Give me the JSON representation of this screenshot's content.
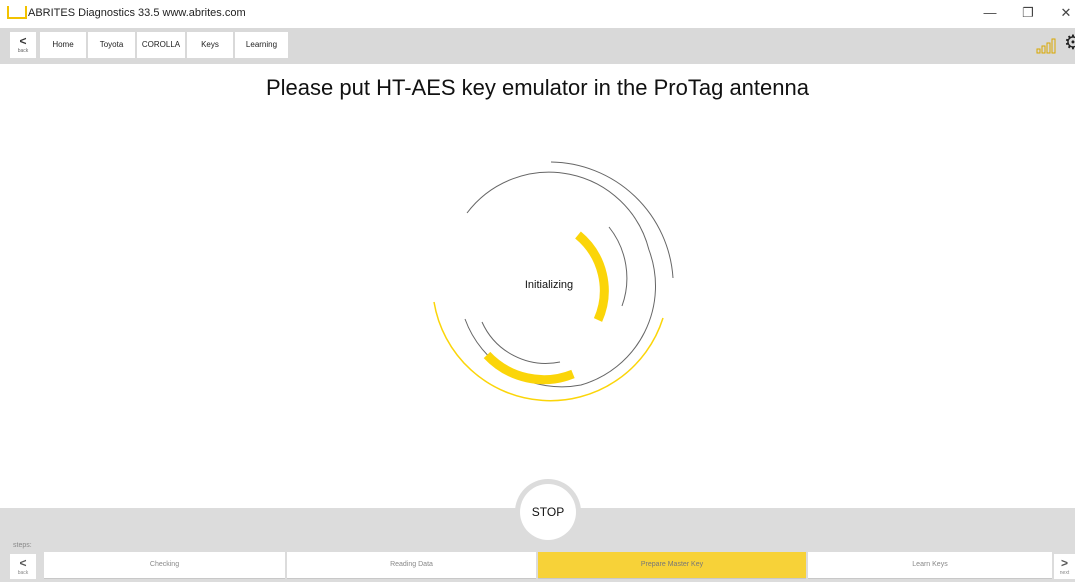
{
  "app": {
    "title": "ABRITES Diagnostics 33.5   www.abrites.com",
    "minimize_glyph": "—",
    "restore_glyph": "❐",
    "close_glyph": "✕"
  },
  "toolbar": {
    "back_arrow": "<",
    "back_label": "back",
    "breadcrumbs": [
      "Home",
      "Toyota",
      "COROLLA",
      "Keys",
      "Learning"
    ],
    "signal_icon": "signal-strength-icon",
    "settings_icon": "gear-icon",
    "settings_glyph": "⚙"
  },
  "main": {
    "heading": "Please put HT-AES key emulator in the ProTag antenna",
    "status": "Initializing",
    "stop_label": "STOP"
  },
  "steps": {
    "label": "steps:",
    "back_arrow": "<",
    "back_label": "back",
    "next_arrow": ">",
    "next_label": "next",
    "items": [
      "Checking",
      "Reading Data",
      "Prepare Master Key",
      "Learn Keys"
    ],
    "active_index": 2
  },
  "colors": {
    "accent": "#f7d238",
    "spinner_yellow": "#fbd509",
    "toolbar_bg": "#d9d9d9",
    "bottom_bg": "#dcdcdc"
  }
}
